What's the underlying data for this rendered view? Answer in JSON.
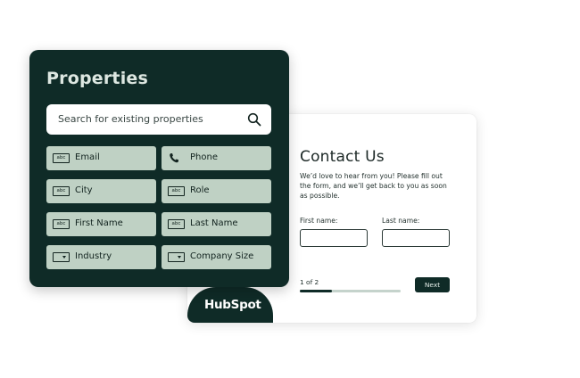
{
  "properties_panel": {
    "title": "Properties",
    "search": {
      "placeholder": "Search for existing properties",
      "icon": "search-icon"
    },
    "items": [
      {
        "label": "Email",
        "icon": "text-field-icon"
      },
      {
        "label": "Phone",
        "icon": "phone-icon"
      },
      {
        "label": "City",
        "icon": "text-field-icon"
      },
      {
        "label": "Role",
        "icon": "text-field-icon"
      },
      {
        "label": "First Name",
        "icon": "text-field-icon"
      },
      {
        "label": "Last Name",
        "icon": "text-field-icon"
      },
      {
        "label": "Industry",
        "icon": "dropdown-icon"
      },
      {
        "label": "Company Size",
        "icon": "dropdown-icon"
      }
    ],
    "text_icon_label": "abc"
  },
  "form": {
    "title": "Contact Us",
    "description": "We’d love to hear from you! Please fill out the form, and we’ll get back to you as soon as possible.",
    "first_name_label": "First name:",
    "last_name_label": "Last name:",
    "page_indicator": "1 of 2",
    "progress": 0.32,
    "next_label": "Next"
  },
  "brand": {
    "name": "HubSpot"
  },
  "colors": {
    "panel_bg": "#0f2b27",
    "chip_bg": "#bfd1c4",
    "accent": "#0f2b27"
  }
}
